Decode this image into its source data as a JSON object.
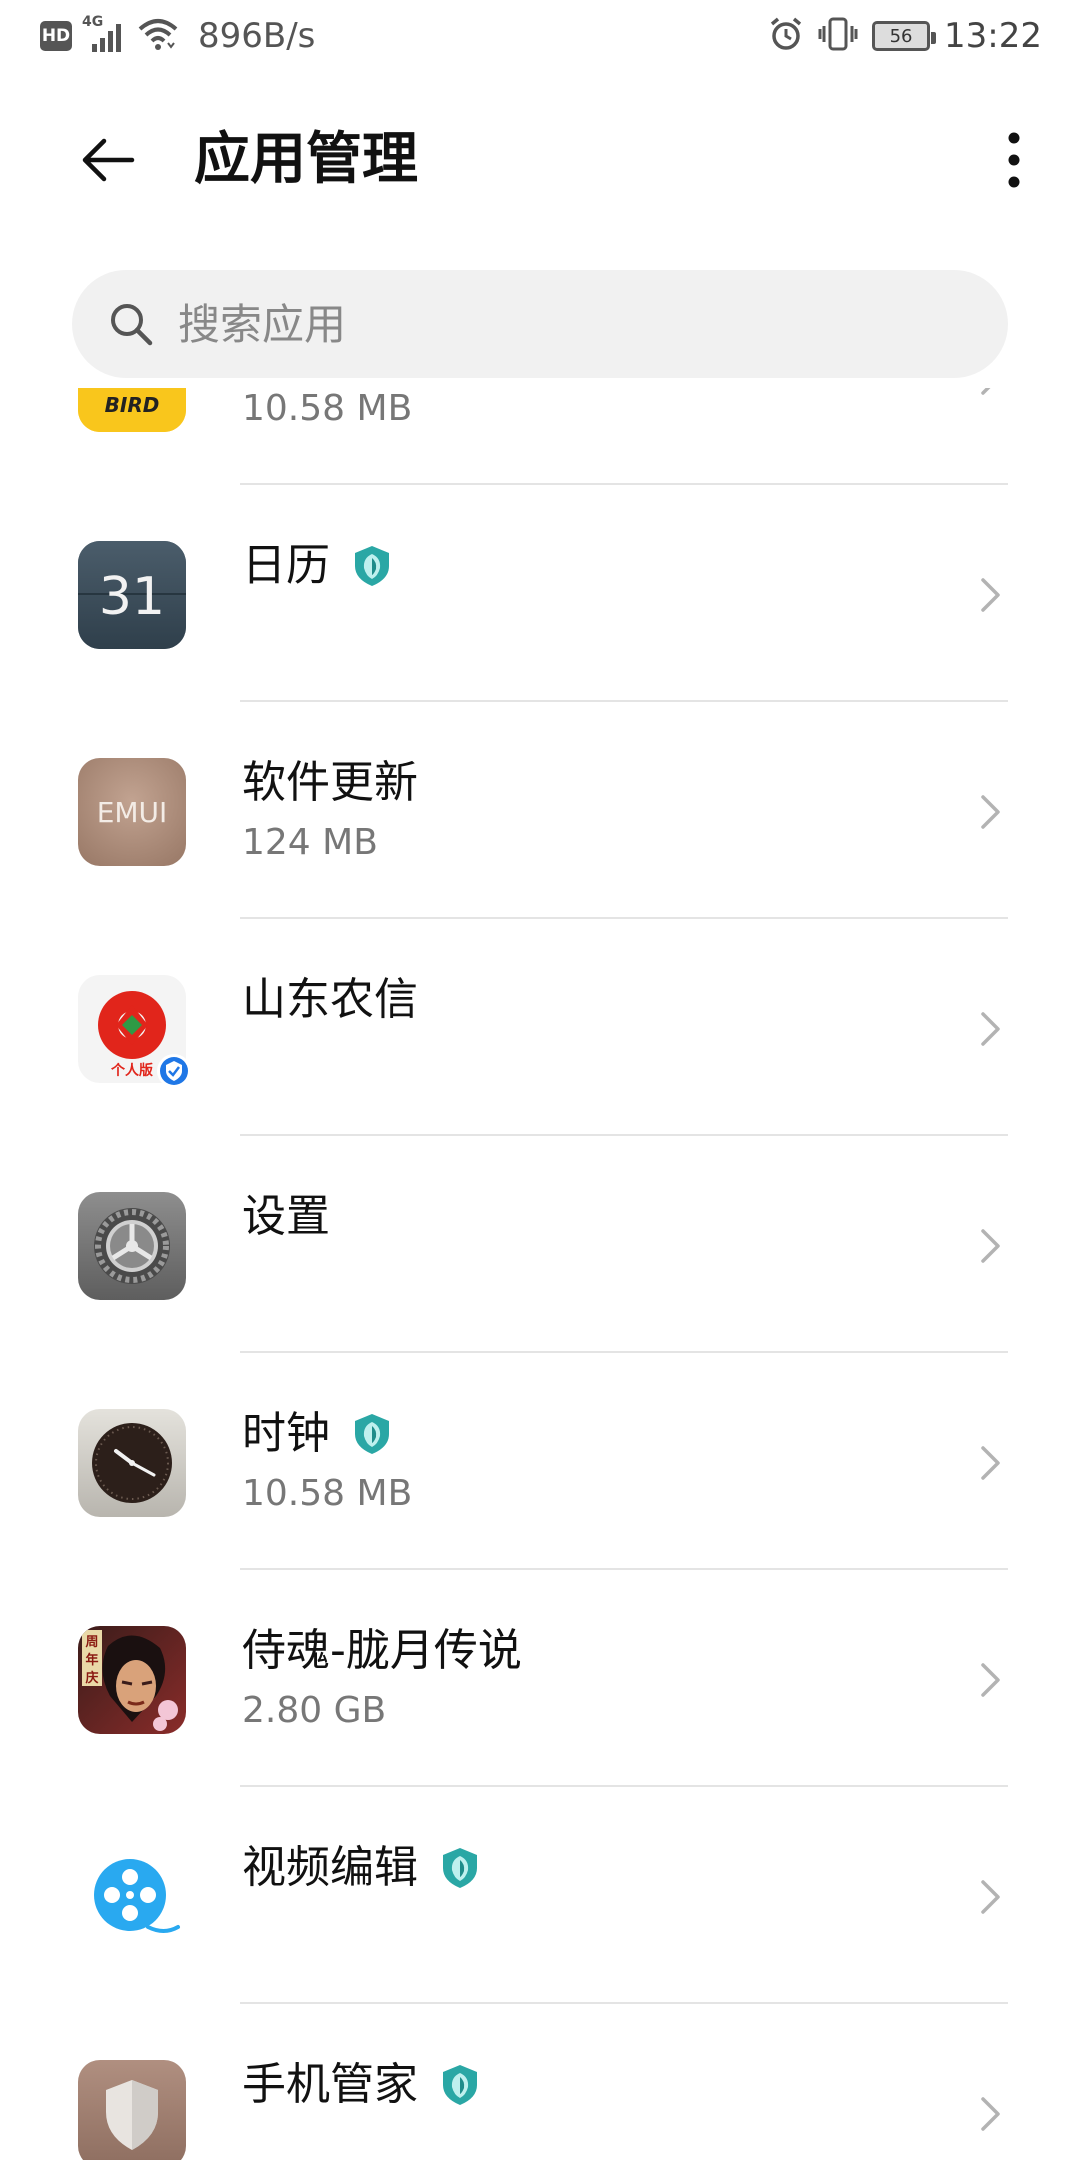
{
  "status_bar": {
    "hd": "HD",
    "network": "4G",
    "speed": "896B/s",
    "battery": "56",
    "time": "13:22"
  },
  "header": {
    "title": "应用管理"
  },
  "search": {
    "placeholder": "搜索应用"
  },
  "apps": [
    {
      "name": "",
      "size": "10.58 MB",
      "icon": "bird-icon",
      "verified": false
    },
    {
      "name": "日历",
      "size": "",
      "icon": "calendar-icon",
      "verified": true,
      "icon_text": "31"
    },
    {
      "name": "软件更新",
      "size": "124 MB",
      "icon": "emui-icon",
      "verified": false,
      "icon_text": "EMUI"
    },
    {
      "name": "山东农信",
      "size": "",
      "icon": "bank-icon",
      "verified": false,
      "icon_text": "个人版"
    },
    {
      "name": "设置",
      "size": "",
      "icon": "settings-gear-icon",
      "verified": false
    },
    {
      "name": "时钟",
      "size": "10.58 MB",
      "icon": "clock-icon",
      "verified": true
    },
    {
      "name": "侍魂-胧月传说",
      "size": "2.80 GB",
      "icon": "game-icon",
      "verified": false,
      "icon_text": "周年庆"
    },
    {
      "name": "视频编辑",
      "size": "",
      "icon": "video-editor-icon",
      "verified": true
    },
    {
      "name": "手机管家",
      "size": "",
      "icon": "phone-manager-icon",
      "verified": true
    }
  ],
  "colors": {
    "shield": "#2aa7a5",
    "divider": "#e4e4e4",
    "search_bg": "#f1f1f1"
  }
}
